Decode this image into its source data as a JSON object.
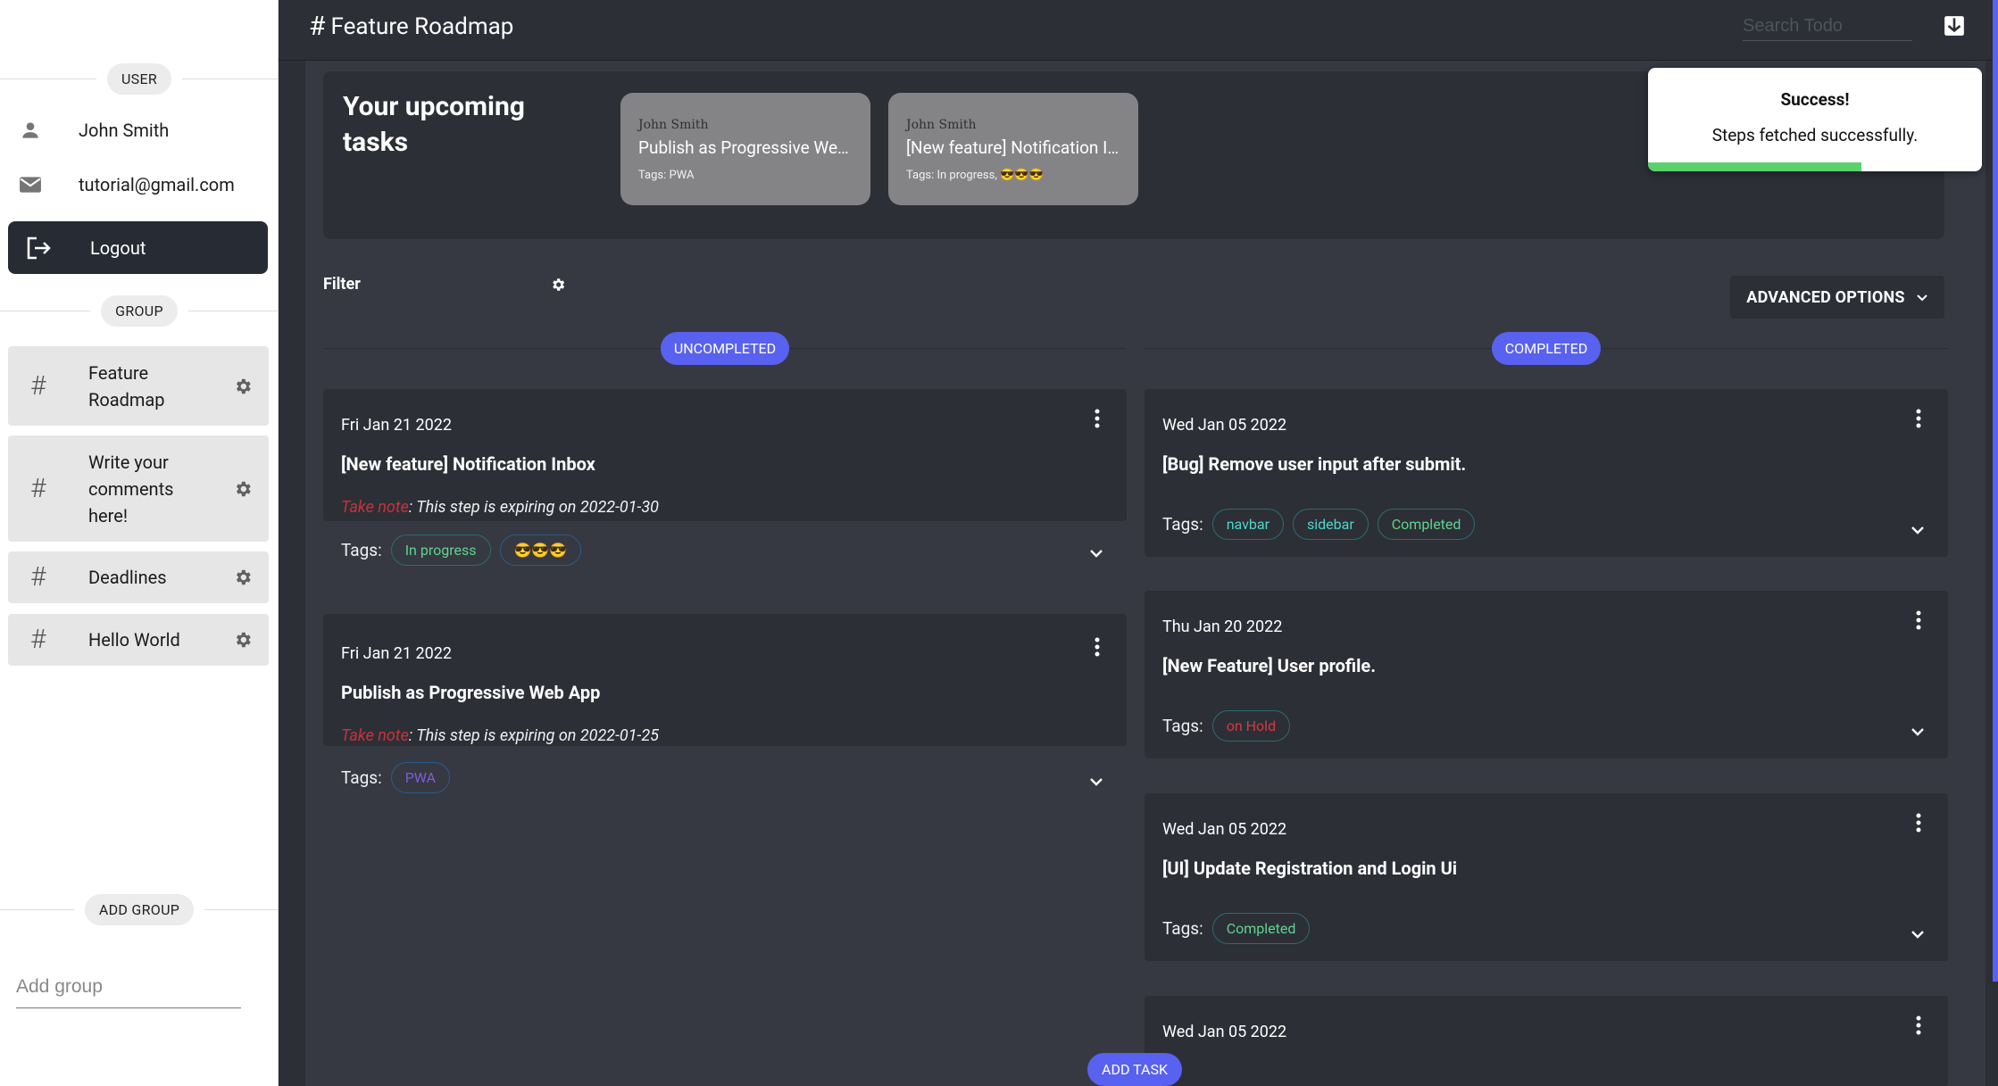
{
  "sidebar": {
    "user_chip": "USER",
    "user_name": "John Smith",
    "user_email": "tutorial@gmail.com",
    "logout_label": "Logout",
    "group_chip": "GROUP",
    "groups": [
      {
        "label": "Feature Roadmap"
      },
      {
        "label": "Write your comments here!"
      },
      {
        "label": "Deadlines"
      },
      {
        "label": "Hello World"
      }
    ],
    "add_group_chip": "ADD GROUP",
    "add_group_placeholder": "Add group"
  },
  "header": {
    "title": "Feature Roadmap",
    "search_placeholder": "Search Todo"
  },
  "upcoming": {
    "title": "Your upcoming tasks",
    "cards": [
      {
        "author": "John Smith",
        "title": "Publish as Progressive Web App",
        "tags": "Tags: PWA"
      },
      {
        "author": "John Smith",
        "title": "[New feature] Notification Inbox",
        "tags": "Tags: In progress, 😎😎😎"
      }
    ]
  },
  "filter": {
    "label": "Filter",
    "advanced_label": "ADVANCED OPTIONS"
  },
  "columns": {
    "uncompleted_label": "UNCOMPLETED",
    "completed_label": "COMPLETED"
  },
  "tasks_uncompleted": [
    {
      "date": "Fri Jan 21 2022",
      "title": "[New feature] Notification Inbox",
      "note_prefix": "Take note",
      "note_text": ": This step is expiring on 2022-01-30",
      "tags_label": "Tags:",
      "tags": [
        "In progress",
        "😎😎😎"
      ]
    },
    {
      "date": "Fri Jan 21 2022",
      "title": "Publish as Progressive Web App",
      "note_prefix": "Take note",
      "note_text": ": This step is expiring on 2022-01-25",
      "tags_label": "Tags:",
      "tags": [
        "PWA"
      ]
    }
  ],
  "tasks_completed": [
    {
      "date": "Wed Jan 05 2022",
      "title": "[Bug] Remove user input after submit.",
      "tags_label": "Tags:",
      "tags": [
        "navbar",
        "sidebar",
        "Completed"
      ]
    },
    {
      "date": "Thu Jan 20 2022",
      "title": "[New Feature] User profile.",
      "tags_label": "Tags:",
      "tags": [
        "on Hold"
      ]
    },
    {
      "date": "Wed Jan 05 2022",
      "title": "[UI] Update Registration and Login Ui",
      "tags_label": "Tags:",
      "tags": [
        "Completed"
      ]
    },
    {
      "date": "Wed Jan 05 2022"
    }
  ],
  "add_task_label": "ADD TASK",
  "toast": {
    "title": "Success!",
    "message": "Steps fetched successfully.",
    "progress": 0.64
  },
  "colors": {
    "accent": "#5861f0",
    "sidebar_active": "#272b34",
    "card_bg": "#2c2f36",
    "main_bg": "#363942",
    "warn": "#c9323c",
    "success": "#5bd16e"
  }
}
